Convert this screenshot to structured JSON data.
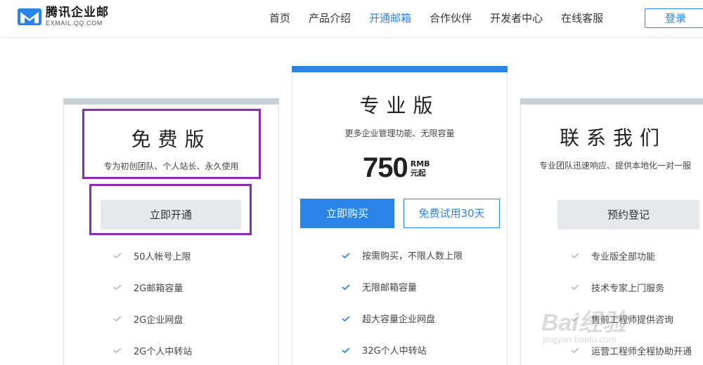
{
  "header": {
    "logo_title": "腾讯企业邮",
    "logo_sub": "EXMAIL.QQ.COM",
    "nav": [
      "首页",
      "产品介绍",
      "开通邮箱",
      "合作伙伴",
      "开发者中心",
      "在线客服"
    ],
    "active_nav": "开通邮箱",
    "login_label": "登录"
  },
  "plans": {
    "free": {
      "title": "免费版",
      "desc": "专为初创团队、个人站长、永久使用",
      "button": "立即开通",
      "features": [
        "50人帐号上限",
        "2G邮箱容量",
        "2G企业网盘",
        "2G个人中转站"
      ]
    },
    "pro": {
      "title": "专业版",
      "desc": "更多企业管理功能、无限容量",
      "price": "750",
      "price_currency": "RMB",
      "price_unit": "元起",
      "buy_button": "立即购买",
      "trial_button": "免费试用30天",
      "features": [
        "按需购买，不限人数上限",
        "无限邮箱容量",
        "超大容量企业网盘",
        "32G个人中转站"
      ]
    },
    "contact": {
      "title": "联系我们",
      "desc": "专业团队迅速响应、提供本地化一对一服",
      "button": "预约登记",
      "features": [
        "专业版全部功能",
        "技术专家上门服务",
        "售前工程师提供咨询",
        "运营工程师全程协助开通"
      ]
    }
  },
  "watermark": {
    "brand": "Bai经验",
    "url": "jingyan.baidu.com"
  },
  "colors": {
    "accent": "#2a84e6",
    "annotation": "#8b2bb8",
    "check_grey": "#b8b8b8"
  }
}
